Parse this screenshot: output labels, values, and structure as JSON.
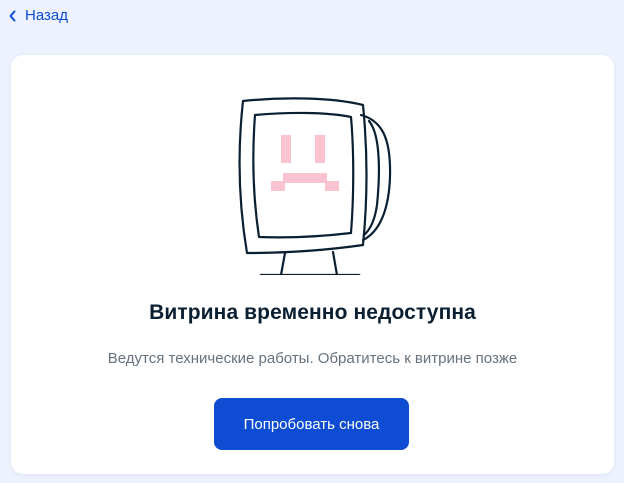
{
  "nav": {
    "back_label": "Назад"
  },
  "card": {
    "title": "Витрина временно недоступна",
    "subtitle": "Ведутся технические работы. Обратитесь к витрине позже",
    "retry_label": "Попробовать снова"
  },
  "illustration": {
    "icon": "sad-computer-monitor",
    "face_color": "#f9c3cf",
    "stroke_color": "#0b1f33"
  },
  "colors": {
    "accent": "#0d4cd3",
    "page_background": "#edf2fe",
    "card_background": "#ffffff",
    "title_text": "#0b1f33",
    "subtitle_text": "#66727f"
  }
}
